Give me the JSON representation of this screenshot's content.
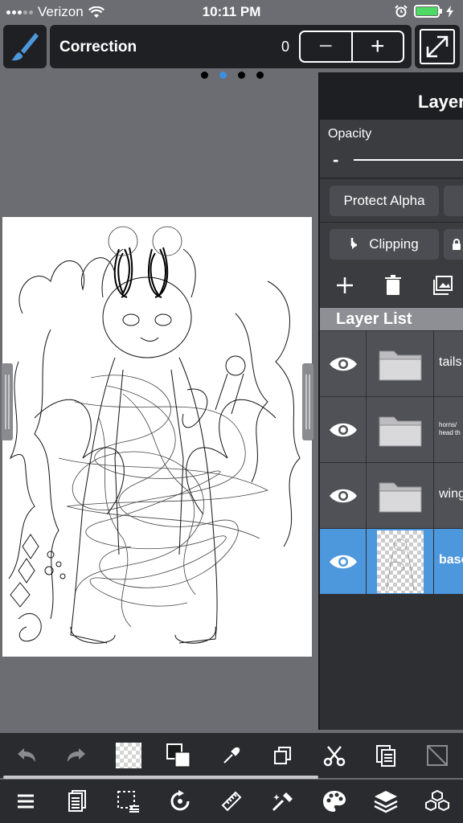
{
  "status_bar": {
    "carrier": "Verizon",
    "time": "10:11 PM",
    "battery_color": "#4cd964"
  },
  "toolbar": {
    "brush_icon": "brush-icon",
    "correction_label": "Correction",
    "correction_value": "0",
    "minus_label": "−",
    "plus_label": "+",
    "expand_icon": "expand-icon"
  },
  "page_dots": {
    "count": 4,
    "active_index": 1
  },
  "layer_panel": {
    "title": "Layer",
    "opacity_label": "Opacity",
    "opacity_minus": "-",
    "protect_alpha_label": "Protect Alpha",
    "clipping_label": "Clipping",
    "layer_list_title": "Layer List",
    "layers": [
      {
        "name": "tails",
        "type": "folder",
        "visible": true,
        "selected": false
      },
      {
        "name": "horns/ head th",
        "type": "folder",
        "visible": true,
        "selected": false
      },
      {
        "name": "wing",
        "type": "folder",
        "visible": true,
        "selected": false
      },
      {
        "name": "base",
        "type": "layer",
        "visible": true,
        "selected": true
      }
    ]
  },
  "accent_color": "#4d97dc"
}
